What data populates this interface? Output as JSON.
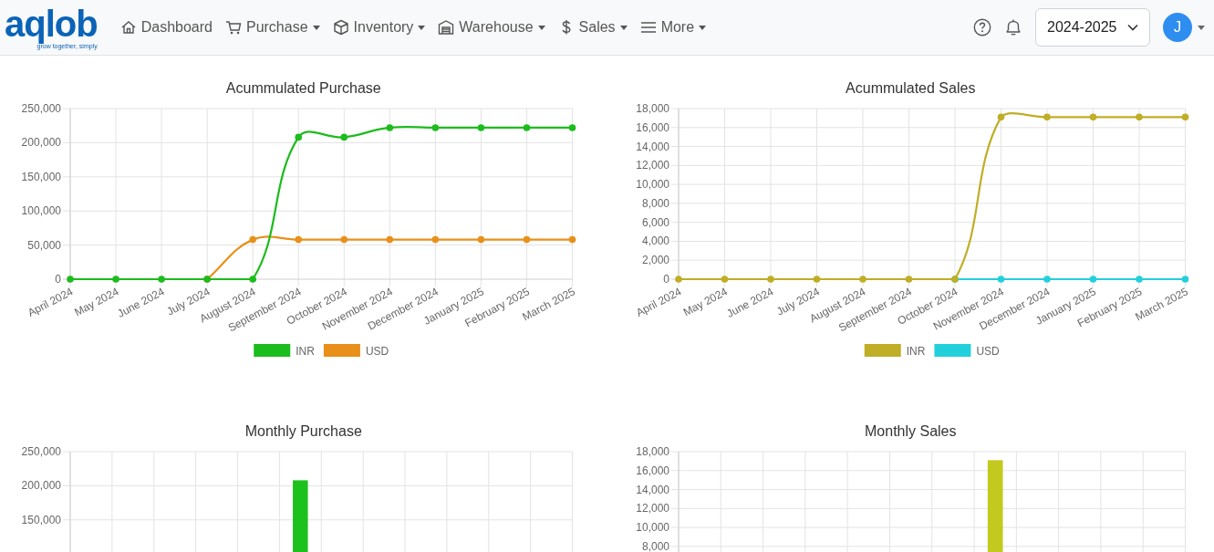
{
  "navbar": {
    "logo": {
      "text": "aqlob",
      "tagline": "grow together, simply"
    },
    "menu": [
      {
        "label": "Dashboard",
        "dropdown": false
      },
      {
        "label": "Purchase",
        "dropdown": true
      },
      {
        "label": "Inventory",
        "dropdown": true
      },
      {
        "label": "Warehouse",
        "dropdown": true
      },
      {
        "label": "Sales",
        "dropdown": true
      },
      {
        "label": "More",
        "dropdown": true
      }
    ],
    "year_select": {
      "value": "2024-2025"
    },
    "avatar": {
      "initial": "J"
    }
  },
  "charts": [
    {
      "chart_data": {
        "type": "line",
        "title": "Acummulated Purchase",
        "categories": [
          "April 2024",
          "May 2024",
          "June 2024",
          "July 2024",
          "August 2024",
          "September 2024",
          "October 2024",
          "November 2024",
          "December 2024",
          "January 2025",
          "February 2025",
          "March 2025"
        ],
        "grid": true,
        "legend": true,
        "series": [
          {
            "name": "INR",
            "color": "#1cbc1c",
            "marker": true,
            "values": [
              0,
              0,
              0,
              0,
              0,
              208000,
              208000,
              222000,
              222000,
              222000,
              222000,
              222000
            ]
          },
          {
            "name": "USD",
            "color": "#e8901a",
            "marker": true,
            "values": [
              null,
              null,
              null,
              0,
              58000,
              58000,
              58000,
              58000,
              58000,
              58000,
              58000,
              58000
            ]
          }
        ],
        "ylim": [
          0,
          250000
        ],
        "yticks": [
          {
            "value": 0,
            "label": "0"
          },
          {
            "value": 50000,
            "label": "50,000"
          },
          {
            "value": 100000,
            "label": "100,000"
          },
          {
            "value": 150000,
            "label": "150,000"
          },
          {
            "value": 200000,
            "label": "200,000"
          },
          {
            "value": 250000,
            "label": "250,000"
          }
        ]
      }
    },
    {
      "chart_data": {
        "type": "line",
        "title": "Acummulated Sales",
        "categories": [
          "April 2024",
          "May 2024",
          "June 2024",
          "July 2024",
          "August 2024",
          "September 2024",
          "October 2024",
          "November 2024",
          "December 2024",
          "January 2025",
          "February 2025",
          "March 2025"
        ],
        "grid": true,
        "legend": true,
        "series": [
          {
            "name": "INR",
            "color": "#bfae26",
            "marker": true,
            "values": [
              0,
              0,
              0,
              0,
              0,
              0,
              0,
              17100,
              17100,
              17100,
              17100,
              17100
            ]
          },
          {
            "name": "USD",
            "color": "#22d0dc",
            "marker": true,
            "values": [
              null,
              null,
              null,
              null,
              null,
              null,
              0,
              0,
              0,
              0,
              0,
              0
            ]
          }
        ],
        "ylim": [
          0,
          18000
        ],
        "yticks": [
          {
            "value": 0,
            "label": "0"
          },
          {
            "value": 2000,
            "label": "2,000"
          },
          {
            "value": 4000,
            "label": "4,000"
          },
          {
            "value": 6000,
            "label": "6,000"
          },
          {
            "value": 8000,
            "label": "8,000"
          },
          {
            "value": 10000,
            "label": "10,000"
          },
          {
            "value": 12000,
            "label": "12,000"
          },
          {
            "value": 14000,
            "label": "14,000"
          },
          {
            "value": 16000,
            "label": "16,000"
          },
          {
            "value": 18000,
            "label": "18,000"
          }
        ]
      }
    },
    {
      "chart_data": {
        "type": "bar",
        "title": "Monthly Purchase",
        "grid": true,
        "series": [
          {
            "color": "#1cc11c",
            "values": [
              null,
              null,
              null,
              null,
              null,
              208000,
              null,
              null,
              null,
              null,
              null,
              null
            ]
          }
        ],
        "ylim": [
          0,
          250000
        ],
        "yticks": [
          {
            "value": 150000,
            "label": "150,000"
          },
          {
            "value": 200000,
            "label": "200,000"
          },
          {
            "value": 250000,
            "label": "250,000"
          }
        ]
      }
    },
    {
      "chart_data": {
        "type": "bar",
        "title": "Monthly Sales",
        "grid": true,
        "series": [
          {
            "color": "#c3c91e",
            "values": [
              null,
              null,
              null,
              null,
              null,
              null,
              null,
              17100,
              null,
              null,
              null,
              null
            ]
          }
        ],
        "ylim": [
          0,
          18000
        ],
        "yticks": [
          {
            "value": 8000,
            "label": "8,000"
          },
          {
            "value": 10000,
            "label": "10,000"
          },
          {
            "value": 12000,
            "label": "12,000"
          },
          {
            "value": 14000,
            "label": "14,000"
          },
          {
            "value": 16000,
            "label": "16,000"
          },
          {
            "value": 18000,
            "label": "18,000"
          }
        ]
      }
    }
  ]
}
